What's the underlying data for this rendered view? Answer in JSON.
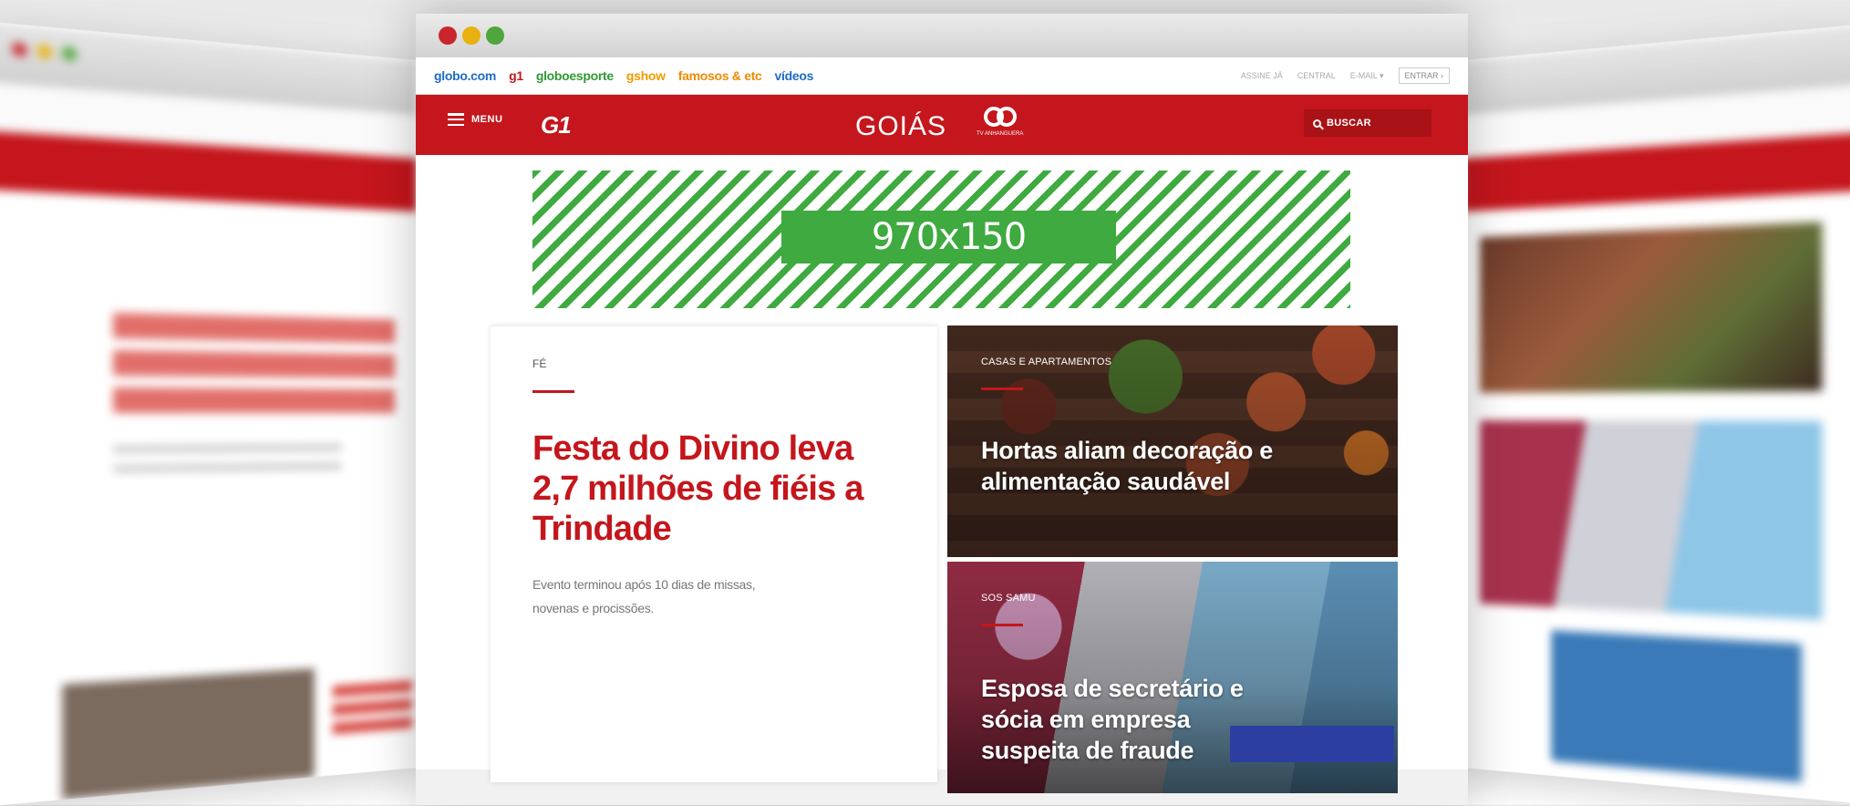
{
  "main_window": {
    "globo_nav": [
      {
        "label": "globo.com",
        "color": "#1f6cc4"
      },
      {
        "label": "g1",
        "color": "#c4161c"
      },
      {
        "label": "globoesporte",
        "color": "#2f9a33"
      },
      {
        "label": "gshow",
        "color": "#f29a00"
      },
      {
        "label": "famosos & etc",
        "color": "#f08a00"
      },
      {
        "label": "vídeos",
        "color": "#1f6cc4"
      }
    ],
    "account_links": {
      "assine": "ASSINE JÁ",
      "central": "CENTRAL",
      "email": "E-MAIL ▾",
      "entrar": "ENTRAR ›"
    },
    "header": {
      "menu_label": "MENU",
      "logo": "G1",
      "region": "GOIÁS",
      "affiliate": "TV ANHANGUERA",
      "search_label": "BUSCAR"
    },
    "ad": {
      "label": "970x150"
    },
    "feature": {
      "category": "FÉ",
      "title": "Festa do Divino leva 2,7 milhões de fiéis a Trindade",
      "subtitle": "Evento terminou após 10 dias de missas, novenas e procissões."
    },
    "cards": [
      {
        "category": "CASAS E APARTAMENTOS",
        "title": "Hortas aliam decoração e alimentação saudável"
      },
      {
        "category": "SOS SAMU",
        "title": "Esposa de secretário e sócia em empresa suspeita de fraude"
      }
    ]
  },
  "colors": {
    "brand_red": "#c4161c",
    "ad_green": "#3faa3f"
  }
}
